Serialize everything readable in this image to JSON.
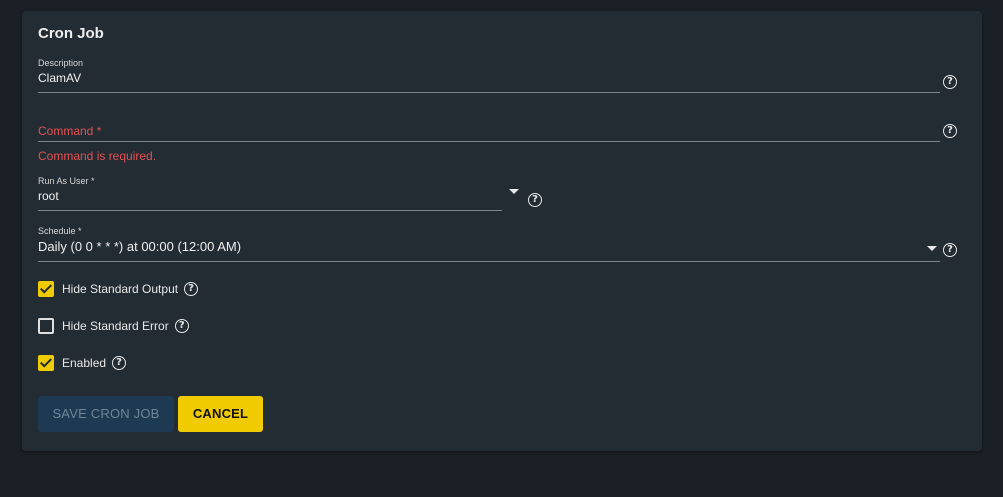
{
  "form": {
    "title": "Cron Job",
    "description": {
      "label": "Description",
      "value": "ClamAV"
    },
    "command": {
      "label": "Command *",
      "value": "",
      "error": "Command is required."
    },
    "run_as_user": {
      "label": "Run As User *",
      "value": "root"
    },
    "schedule": {
      "label": "Schedule *",
      "value": "Daily (0 0 * * *) at 00:00 (12:00 AM)"
    },
    "checkboxes": [
      {
        "label": "Hide Standard Output",
        "checked": true
      },
      {
        "label": "Hide Standard Error",
        "checked": false
      },
      {
        "label": "Enabled",
        "checked": true
      }
    ],
    "buttons": {
      "save": "SAVE CRON JOB",
      "cancel": "CANCEL"
    },
    "help_glyph": "?"
  },
  "colors": {
    "background": "#1b2026",
    "card": "#232b33",
    "accent": "#f0cb00",
    "error": "#e05252",
    "save_disabled": "#1e3a52"
  },
  "icons": [
    "help-circle-icon",
    "dropdown-caret-icon",
    "checkmark-icon"
  ]
}
